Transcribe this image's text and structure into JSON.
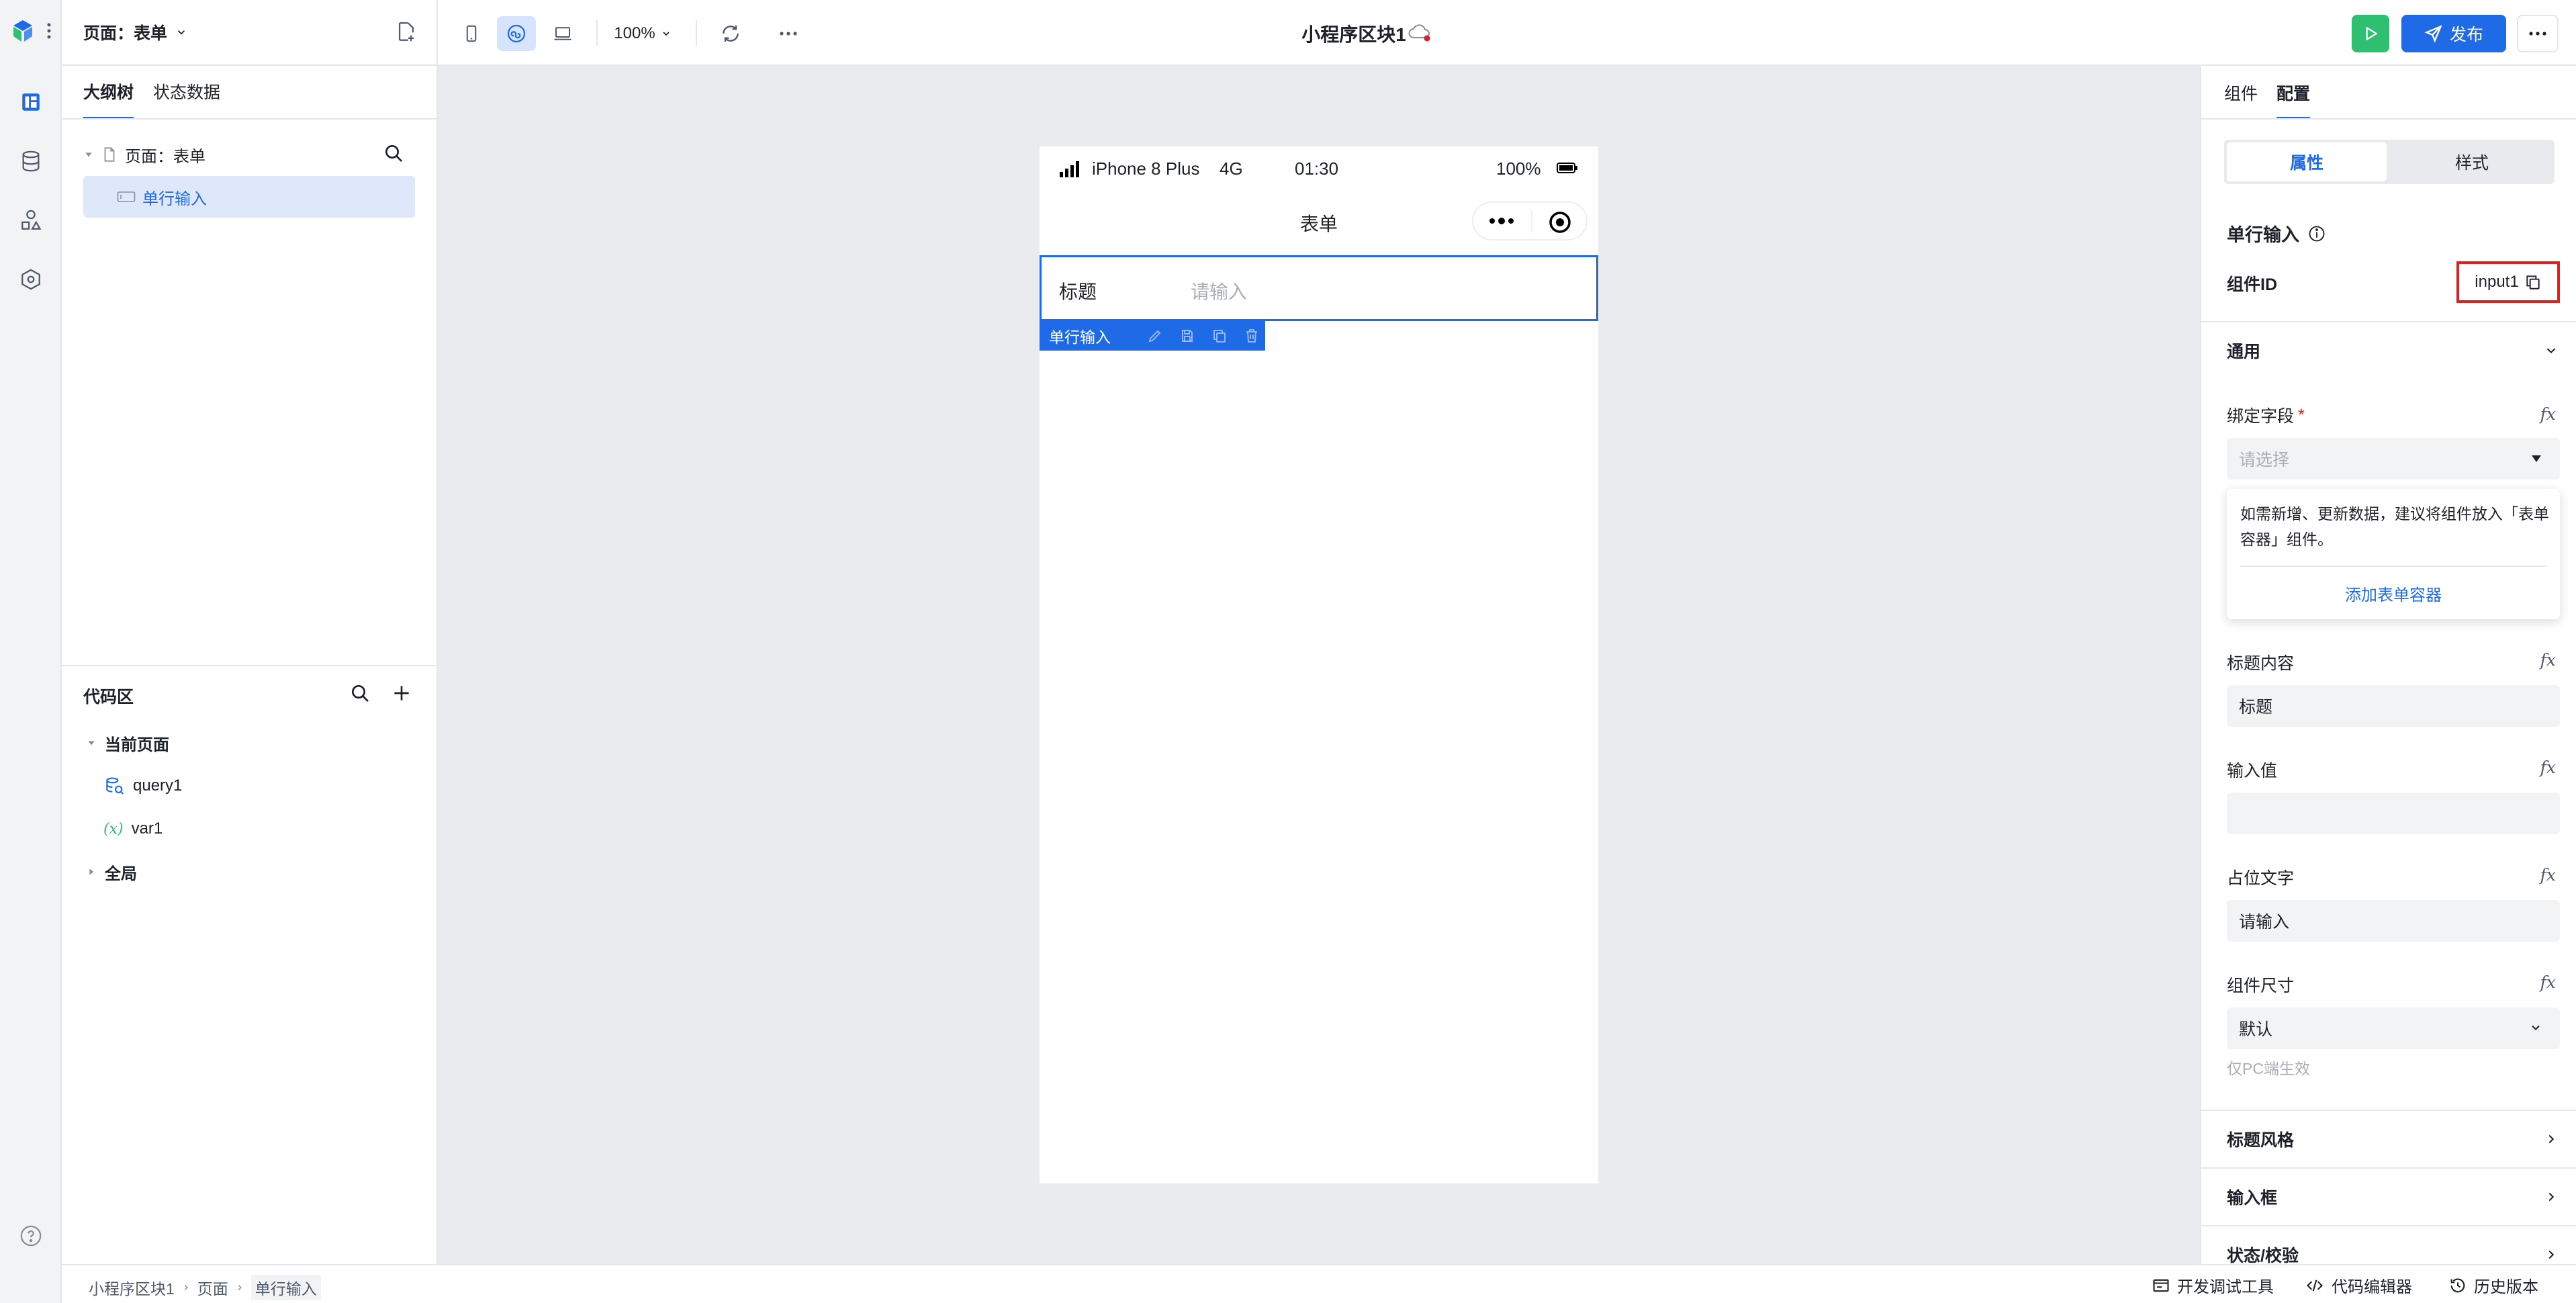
{
  "left_header": {
    "page_title": "页面：表单"
  },
  "left_tabs": [
    {
      "label": "大纲树"
    },
    {
      "label": "状态数据"
    }
  ],
  "outline": {
    "page_node": "页面：表单",
    "child_node": "单行输入"
  },
  "code_area": {
    "title": "代码区",
    "current_page": "当前页面",
    "items": [
      {
        "label": "query1"
      },
      {
        "label": "var1"
      }
    ],
    "global": "全局",
    "var_icon_text": "(x)"
  },
  "toolbar": {
    "zoom": "100%",
    "app_title": "小程序区块1",
    "publish_label": "发布"
  },
  "phone": {
    "carrier": "iPhone 8 Plus",
    "network": "4G",
    "time": "01:30",
    "battery": "100%",
    "nav_title": "表单",
    "field_label": "标题",
    "field_placeholder": "请输入",
    "selection_tag": "单行输入"
  },
  "right_tabs": [
    {
      "label": "组件"
    },
    {
      "label": "配置"
    }
  ],
  "segment": {
    "attrs": "属性",
    "style": "样式"
  },
  "props": {
    "component_title": "单行输入",
    "id_label": "组件ID",
    "id_value": "input1",
    "general_section": "通用",
    "bind_field_label": "绑定字段",
    "required_mark": "*",
    "bind_field_placeholder": "请选择",
    "tip_text": "如需新增、更新数据，建议将组件放入「表单容器」组件。",
    "tip_link": "添加表单容器",
    "title_content_label": "标题内容",
    "title_content_value": "标题",
    "input_value_label": "输入值",
    "input_value_value": "",
    "placeholder_label": "占位文字",
    "placeholder_value": "请输入",
    "size_label": "组件尺寸",
    "size_value": "默认",
    "size_hint": "仅PC端生效",
    "fx_text": "fx",
    "section_title_style": "标题风格",
    "section_input_box": "输入框",
    "section_state": "状态/校验"
  },
  "breadcrumb": [
    "小程序区块1",
    "页面",
    "单行输入"
  ],
  "status_tools": [
    {
      "label": "开发调试工具"
    },
    {
      "label": "代码编辑器"
    },
    {
      "label": "历史版本"
    }
  ],
  "colors": {
    "primary": "#1f6ae7",
    "run": "#2fbf71",
    "highlight_box": "#e02020",
    "selected_bg": "#dfe8fb"
  }
}
